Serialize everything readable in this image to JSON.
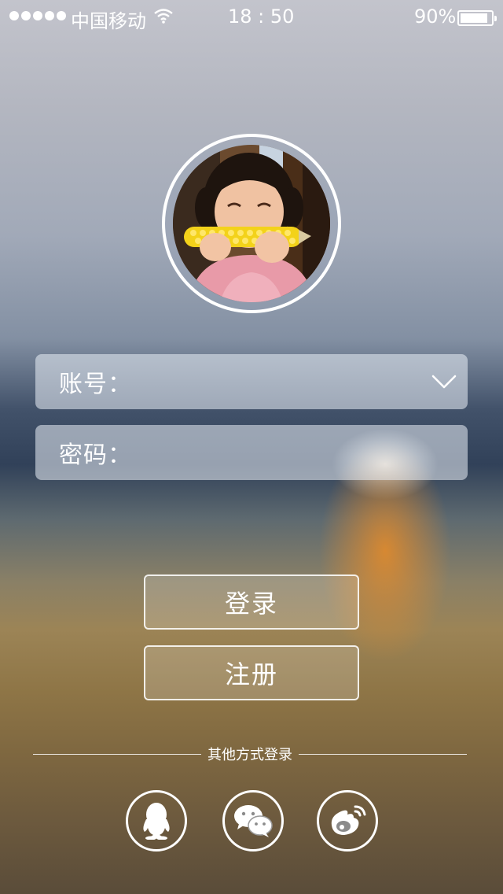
{
  "status_bar": {
    "carrier": "中国移动",
    "time": "18 : 50",
    "battery": "90%",
    "battery_level": 0.9
  },
  "form": {
    "account_label": "账号：",
    "account_value": "",
    "password_label": "密码：",
    "password_value": ""
  },
  "buttons": {
    "login": "登录",
    "register": "注册"
  },
  "other_login": {
    "label": "其他方式登录",
    "providers": [
      "qq-icon",
      "wechat-icon",
      "weibo-icon"
    ]
  }
}
